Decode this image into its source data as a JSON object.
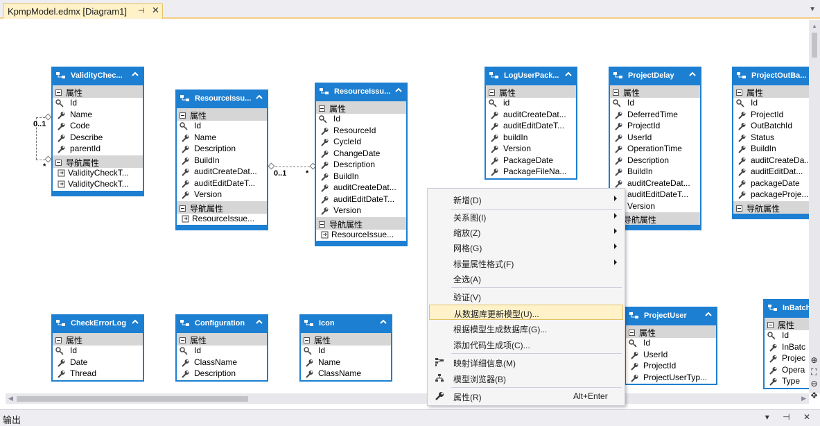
{
  "tab": {
    "title": "KpmpModel.edmx [Diagram1]",
    "pin_glyph": "⊣",
    "close_glyph": "✕"
  },
  "labels": {
    "properties": "属性",
    "navigation": "导航属性"
  },
  "colors": {
    "entity_header": "#1c7fd2",
    "tab_bg": "#fff1c8",
    "highlight": "#fff1c8"
  },
  "entities": {
    "validity": {
      "title": "ValidityChec...",
      "props": [
        "Id",
        "Name",
        "Code",
        "Describe",
        "parentId"
      ],
      "navs": [
        "ValidityCheckT...",
        "ValidityCheckT..."
      ]
    },
    "res1": {
      "title": "ResourceIssu...",
      "props": [
        "Id",
        "Name",
        "Description",
        "BuildIn",
        "auditCreateDat...",
        "auditEditDateT...",
        "Version"
      ],
      "navs": [
        "ResourceIssue..."
      ]
    },
    "res2": {
      "title": "ResourceIssu...",
      "props": [
        "Id",
        "ResourceId",
        "CycleId",
        "ChangeDate",
        "Description",
        "BuildIn",
        "auditCreateDat...",
        "auditEditDateT...",
        "Version"
      ],
      "navs": [
        "ResourceIssue..."
      ]
    },
    "logpack": {
      "title": "LogUserPack...",
      "props": [
        "id",
        "auditCreateDat...",
        "auditEditDateT...",
        "buildIn",
        "Version",
        "PackageDate",
        "PackageFileNa..."
      ],
      "navs": []
    },
    "delay": {
      "title": "ProjectDelay",
      "props": [
        "Id",
        "DeferredTime",
        "ProjectId",
        "UserId",
        "OperationTime",
        "Description",
        "BuildIn",
        "auditCreateDat...",
        "auditEditDateT...",
        "Version"
      ],
      "navs": []
    },
    "outbatch": {
      "title": "ProjectOutBa...",
      "props": [
        "Id",
        "ProjectId",
        "OutBatchId",
        "Status",
        "BuildIn",
        "auditCreateDa...",
        "auditEditDat...",
        "packageDate",
        "packageProje..."
      ],
      "navs": []
    },
    "checkerror": {
      "title": "CheckErrorLog",
      "props": [
        "Id",
        "Date",
        "Thread"
      ]
    },
    "config": {
      "title": "Configuration",
      "props": [
        "Id",
        "ClassName",
        "Description"
      ]
    },
    "icon": {
      "title": "Icon",
      "props": [
        "Id",
        "Name",
        "ClassName"
      ]
    },
    "projuser": {
      "title": "ProjectUser",
      "props": [
        "Id",
        "UserId",
        "ProjectId",
        "ProjectUserTyp..."
      ]
    },
    "inbatch": {
      "title": "InBatch",
      "props": [
        "Id",
        "InBatc",
        "Projec",
        "Opera",
        "Type"
      ]
    }
  },
  "multiplicities": {
    "self_one": "0..1",
    "self_many": "*",
    "rel_one": "0..1",
    "rel_many": "*"
  },
  "context_menu": {
    "items": [
      {
        "label": "新增(D)",
        "submenu": true
      },
      {
        "label": "关系图(I)",
        "submenu": true
      },
      {
        "label": "缩放(Z)",
        "submenu": true
      },
      {
        "label": "网格(G)",
        "submenu": true
      },
      {
        "label": "标量属性格式(F)",
        "submenu": true
      },
      {
        "label": "全选(A)"
      },
      {
        "label": "验证(V)"
      },
      {
        "label": "从数据库更新模型(U)...",
        "highlighted": true
      },
      {
        "label": "根据模型生成数据库(G)..."
      },
      {
        "label": "添加代码生成项(C)..."
      },
      {
        "label": "映射详细信息(M)",
        "icon": "mapping-details-icon"
      },
      {
        "label": "模型浏览器(B)",
        "icon": "model-browser-icon"
      },
      {
        "label": "属性(R)",
        "shortcut": "Alt+Enter",
        "icon": "wrench-icon"
      }
    ]
  },
  "output_panel": {
    "title": "输出",
    "controls": "▾ ⊣ ✕"
  }
}
